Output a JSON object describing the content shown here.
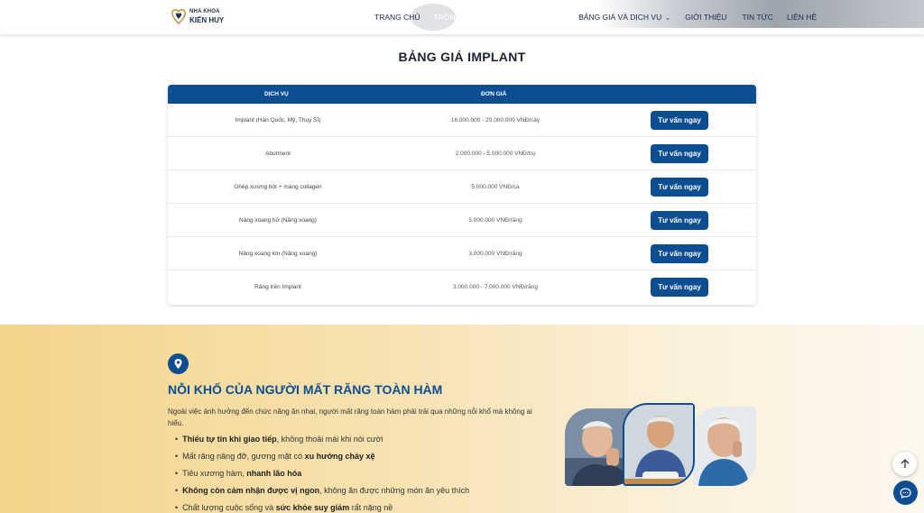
{
  "header": {
    "logo": {
      "line1": "NHA KHOA",
      "line2": "KIẾN HUY"
    },
    "nav": [
      {
        "label": "TRANG CHỦ",
        "active": false
      },
      {
        "label": "TRỒNG RĂNG IMPLANT TOÀN HÀM",
        "active": true
      },
      {
        "label": "BẢNG GIÁ VÀ DỊCH VỤ",
        "active": false,
        "has_dropdown": true
      },
      {
        "label": "GIỚI THIỆU",
        "active": false
      },
      {
        "label": "TIN TỨC",
        "active": false
      },
      {
        "label": "LIÊN HỆ",
        "active": false
      }
    ]
  },
  "pricing": {
    "title": "BẢNG GIÁ IMPLANT",
    "columns": {
      "service": "DỊCH VỤ",
      "price": "ĐƠN GIÁ"
    },
    "rows": [
      {
        "service": "Implant (Hàn Quốc, Mỹ, Thụy Sĩ)",
        "price": "16.000.000 - 20.000.000 VNĐ/cây",
        "cta": "Tư vấn ngay"
      },
      {
        "service": "Abutment",
        "price": "2.000.000 - 5.000.000 VNĐ/trụ",
        "cta": "Tư vấn ngay"
      },
      {
        "service": "Ghép xương bột + màng collagen",
        "price": "5.000.000 VNĐ/ca",
        "cta": "Tư vấn ngay"
      },
      {
        "service": "Nâng xoang hở (Nâng xoang)",
        "price": "5.000.000 VNĐ/răng",
        "cta": "Tư vấn ngay"
      },
      {
        "service": "Nâng xoang kín (Nâng xoang)",
        "price": "3.000.000 VNĐ/răng",
        "cta": "Tư vấn ngay"
      },
      {
        "service": "Răng trên Implant",
        "price": "3.000.000 - 7.000.000 VNĐ/răng",
        "cta": "Tư vấn ngay"
      }
    ]
  },
  "pain_section": {
    "title": "NỖI KHỔ CỦA NGƯỜI MẤT RĂNG TOÀN HÀM",
    "intro": "Ngoài việc ảnh hưởng đến chức năng ăn nhai, người mất răng toàn hàm phải trải qua những nỗi khổ mà không ai hiểu.",
    "items": [
      {
        "bold": "Thiếu tự tin khi giao tiếp",
        "rest": ", không thoải mái khi nói cười",
        "bold_first": true
      },
      {
        "before": "Mất răng nâng đỡ, gương mặt có ",
        "bold": "xu hướng chảy xệ",
        "rest": ""
      },
      {
        "before": "Tiêu xương hàm, ",
        "bold": "nhanh lão hóa",
        "rest": ""
      },
      {
        "bold": "Không còn cảm nhận được vị ngon",
        "rest": ", không ăn được những món ăn yêu thích",
        "bold_first": true
      },
      {
        "before": "Chất lượng cuộc sống và ",
        "bold": "sức khỏe suy giảm",
        "rest": " rất nặng nề"
      }
    ]
  },
  "colors": {
    "primary": "#0d4d92",
    "yellow": "#f3d48a",
    "text": "#333333"
  },
  "icons": {
    "pin": "map-pin-icon",
    "scroll_top": "arrow-up-icon",
    "chat": "chat-bubble-icon"
  }
}
